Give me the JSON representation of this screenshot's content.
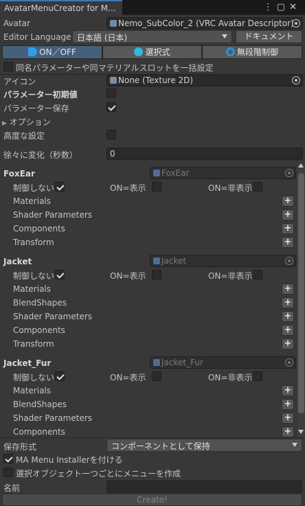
{
  "window": {
    "tab_title": "AvatarMenuCreator for M...",
    "icons": [
      "more-icon",
      "maximize-icon",
      "close-icon"
    ]
  },
  "avatar": {
    "label": "Avatar",
    "value": "Nemo_SubColor_2 (VRC Avatar Descriptor)"
  },
  "editor_language": {
    "label": "Editor Language",
    "value": "日本語 (日本)",
    "doc_button": "ドキュメント"
  },
  "mode_tabs": [
    {
      "label": "ON／OFF",
      "active": true,
      "color": "#2e9ee8"
    },
    {
      "label": "選択式",
      "active": false,
      "color": "#32b5e0"
    },
    {
      "label": "無段階制御",
      "active": false,
      "color": "#2f8fd8"
    }
  ],
  "bulk_setting": {
    "label": "同名パラメーターや同マテリアルスロットを一括設定",
    "checked": false
  },
  "icon_field": {
    "label": "アイコン",
    "value": "None (Texture 2D)"
  },
  "param_initial": {
    "label": "パラメーター初期値",
    "checked": false
  },
  "param_save": {
    "label": "パラメーター保存",
    "checked": true
  },
  "options": {
    "label": "オプション"
  },
  "advanced": {
    "label": "高度な設定",
    "checked": false
  },
  "gradual": {
    "label": "徐々に変化（秒数）",
    "value": "0"
  },
  "groups": [
    {
      "name": "FoxEar",
      "object": "FoxEar",
      "no_control": "制御しない",
      "on_show": "ON=表示",
      "on_hide": "ON=非表示",
      "items": [
        "Materials",
        "Shader Parameters",
        "Components",
        "Transform"
      ]
    },
    {
      "name": "Jacket",
      "object": "Jacket",
      "no_control": "制御しない",
      "on_show": "ON=表示",
      "on_hide": "ON=非表示",
      "items": [
        "Materials",
        "BlendShapes",
        "Shader Parameters",
        "Components",
        "Transform"
      ]
    },
    {
      "name": "Jacket_Fur",
      "object": "Jacket_Fur",
      "no_control": "制御しない",
      "on_show": "ON=表示",
      "on_hide": "ON=非表示",
      "items": [
        "Materials",
        "BlendShapes",
        "Shader Parameters",
        "Components"
      ]
    }
  ],
  "save_format": {
    "label": "保存形式",
    "value": "コンポーネントとして保持"
  },
  "ma_installer": {
    "label": "MA Menu Installerを付ける",
    "checked": true
  },
  "per_object": {
    "label": "選択オブジェクト一つごとにメニューを作成",
    "checked": false
  },
  "name_field": {
    "label": "名前",
    "value": ""
  },
  "create_button": "Create!"
}
